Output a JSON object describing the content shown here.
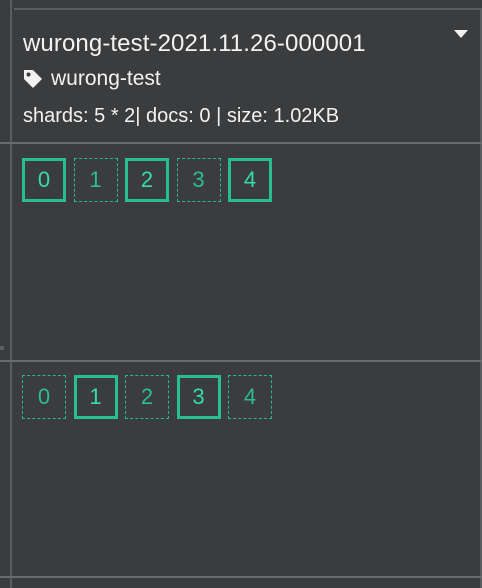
{
  "index": {
    "name": "wurong-test-2021.11.26-000001",
    "alias": "wurong-test",
    "stats": "shards: 5 * 2| docs: 0 | size: 1.02KB"
  },
  "nodes": [
    {
      "shards": [
        {
          "label": "0",
          "kind": "primary"
        },
        {
          "label": "1",
          "kind": "replica"
        },
        {
          "label": "2",
          "kind": "primary"
        },
        {
          "label": "3",
          "kind": "replica"
        },
        {
          "label": "4",
          "kind": "primary"
        }
      ]
    },
    {
      "shards": [
        {
          "label": "0",
          "kind": "replica"
        },
        {
          "label": "1",
          "kind": "primary"
        },
        {
          "label": "2",
          "kind": "replica"
        },
        {
          "label": "3",
          "kind": "primary"
        },
        {
          "label": "4",
          "kind": "replica"
        }
      ]
    }
  ],
  "icons": {
    "alias": "tag-icon",
    "menu": "caret-down-icon"
  },
  "colors": {
    "background": "#3b3c3e",
    "shard_accent": "#26c08f",
    "text": "#f2f2f2"
  }
}
